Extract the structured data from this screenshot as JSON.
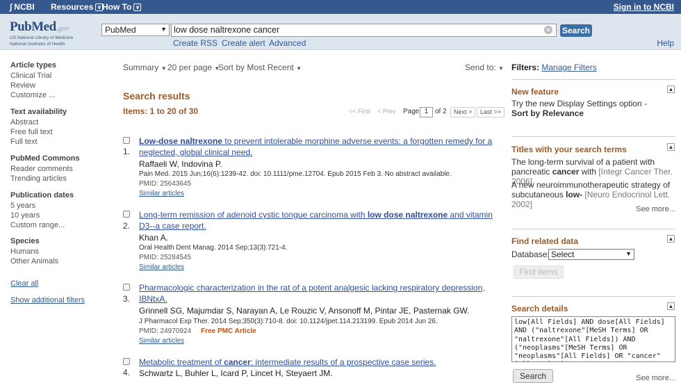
{
  "topbar": {
    "ncbi": "NCBI",
    "resources": "Resources",
    "howto": "How To",
    "signin": "Sign in to NCBI"
  },
  "logo": {
    "word_pub": "Pub",
    "word_med": "Med",
    "gov": ".gov",
    "line1": "US National Library of Medicine",
    "line2": "National Institutes of Health"
  },
  "search": {
    "db": "PubMed",
    "query": "low dose naltrexone cancer",
    "button": "Search"
  },
  "subnav": {
    "rss": "Create RSS",
    "alert": "Create alert",
    "advanced": "Advanced",
    "help": "Help"
  },
  "sidebar": {
    "article_types": "Article types",
    "at_items": [
      "Clinical Trial",
      "Review",
      "Customize ..."
    ],
    "text_availability": "Text availability",
    "ta_items": [
      "Abstract",
      "Free full text",
      "Full text"
    ],
    "pubmed_commons": "PubMed Commons",
    "pc_items": [
      "Reader comments",
      "Trending articles"
    ],
    "publication_dates": "Publication dates",
    "pd_items": [
      "5 years",
      "10 years",
      "Custom range..."
    ],
    "species": "Species",
    "sp_items": [
      "Humans",
      "Other Animals"
    ],
    "clear_all": "Clear all",
    "show_filters": "Show additional filters"
  },
  "toolbar": {
    "summary": "Summary",
    "per_page": "20 per page",
    "sort": "Sort by Most Recent",
    "send_to": "Send to:"
  },
  "results": {
    "heading": "Search results",
    "items": "Items: 1 to 20 of 30",
    "pager": {
      "first": "<< First",
      "prev": "< Prev",
      "page_label": "Page",
      "page": "1",
      "of": "of 2",
      "next": "Next >",
      "last": "Last >>"
    },
    "list": [
      {
        "num": "1.",
        "title_bold": "Low-dose naltrexone",
        "title_rest": " to prevent intolerable morphine adverse events: a forgotten remedy for a neglected, global clinical need.",
        "authors": "Raffaeli W, Indovina P.",
        "citation": "Pain Med. 2015 Jun;16(6):1239-42. doi: 10.1111/pme.12704. Epub 2015 Feb 3. No abstract available.",
        "pmid": "PMID: 25643645",
        "pmc": "",
        "similar": "Similar articles"
      },
      {
        "num": "2.",
        "title_pre": "Long-term remission of adenoid cystic tongue carcinoma with ",
        "title_bold": "low dose naltrexone",
        "title_rest": " and vitamin D3--a case report.",
        "authors": "Khan A.",
        "citation": "Oral Health Dent Manag. 2014 Sep;13(3):721-4.",
        "pmid": "PMID: 25284545",
        "pmc": "",
        "similar": "Similar articles"
      },
      {
        "num": "3.",
        "title_rest": "Pharmacologic characterization in the rat of a potent analgesic lacking respiratory depression, IBNtxA.",
        "authors": "Grinnell SG, Majumdar S, Narayan A, Le Rouzic V, Ansonoff M, Pintar JE, Pasternak GW.",
        "citation": "J Pharmacol Exp Ther. 2014 Sep;350(3):710-8. doi: 10.1124/jpet.114.213199. Epub 2014 Jun 26.",
        "pmid": "PMID: 24970924",
        "pmc": "Free PMC Article",
        "similar": "Similar articles"
      },
      {
        "num": "4.",
        "title_pre": "Metabolic treatment of ",
        "title_bold": "cancer",
        "title_rest": ": intermediate results of a prospective case series.",
        "authors": "Schwartz L, Buhler L, Icard P, Lincet H, Steyaert JM."
      }
    ]
  },
  "right": {
    "filters_label": "Filters:",
    "manage_filters": "Manage Filters",
    "new_feature": {
      "title": "New feature",
      "line1": "Try the new Display Settings option -",
      "line2": "Sort by Relevance"
    },
    "titles": {
      "title": "Titles with your search terms",
      "item1_a": "The long-term survival of a patient with pancreatic ",
      "item1_b": "cancer",
      "item1_c": " with ",
      "item1_src": "[Integr Cancer Ther. 2006]",
      "item2_a": "A new neuroimmunotherapeutic strategy of subcutaneous ",
      "item2_b": "low-",
      "item2_src": "[Neuro Endocrinol Lett. 2002]",
      "see_more": "See more..."
    },
    "related": {
      "title": "Find related data",
      "db_label": "Database:",
      "db_value": "Select",
      "find_items": "Find items"
    },
    "details": {
      "title": "Search details",
      "text": "low[All Fields] AND dose[All Fields] AND (\"naltrexone\"[MeSH Terms] OR \"naltrexone\"[All Fields]) AND (\"neoplasms\"[MeSH Terms] OR \"neoplasms\"[All Fields] OR \"cancer\"[All Fields])",
      "search_btn": "Search",
      "see_more": "See more..."
    }
  }
}
